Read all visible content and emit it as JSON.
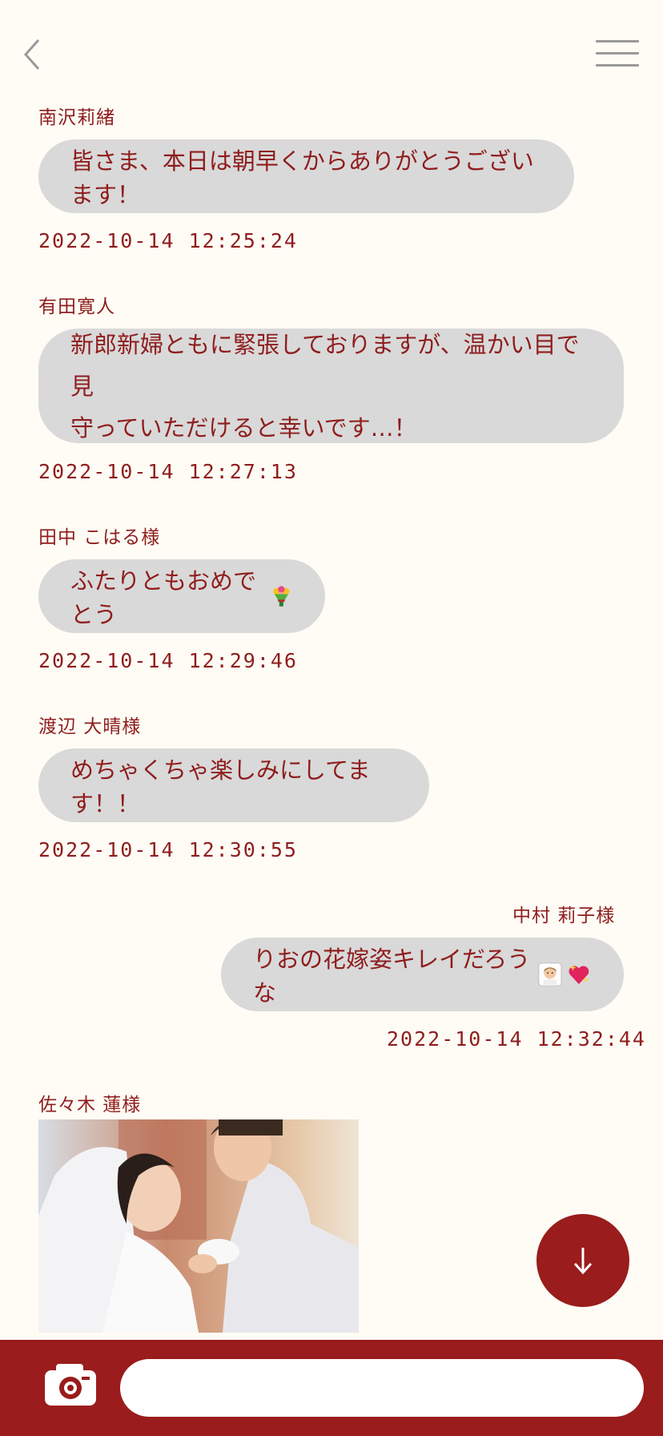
{
  "header": {
    "back_icon": "chevron-left-icon",
    "menu_icon": "hamburger-menu-icon"
  },
  "messages": [
    {
      "sender": "南沢莉緒",
      "text": "皆さま、本日は朝早くからありがとうございます！",
      "timestamp": "2022-10-14 12:25:24",
      "side": "left"
    },
    {
      "sender": "有田寛人",
      "text_line1": "新郎新婦ともに緊張しておりますが、温かい目で見",
      "text_line2": "守っていただけると幸いです…！",
      "timestamp": "2022-10-14 12:27:13",
      "side": "left"
    },
    {
      "sender": "田中 こはる様",
      "text": "ふたりともおめでとう",
      "emoji": "bouquet-icon",
      "timestamp": "2022-10-14 12:29:46",
      "side": "left"
    },
    {
      "sender": "渡辺 大晴様",
      "text": "めちゃくちゃ楽しみにしてます！！",
      "timestamp": "2022-10-14 12:30:55",
      "side": "left"
    },
    {
      "sender": "中村 莉子様",
      "text": "りおの花嫁姿キレイだろうな",
      "emoji": [
        "bride-with-veil-icon",
        "sparkling-heart-icon"
      ],
      "timestamp": "2022-10-14 12:32:44",
      "side": "right"
    },
    {
      "sender": "佐々木 蓮様",
      "image": "wedding-couple-photo",
      "side": "left"
    }
  ],
  "scroll_button": {
    "icon": "arrow-down-icon"
  },
  "composer": {
    "camera_icon": "camera-icon",
    "input_value": "",
    "input_placeholder": ""
  },
  "colors": {
    "background": "#fefcf5",
    "accent": "#9a1c1c",
    "text": "#8f1d1d",
    "bubble": "#d9d9d9"
  }
}
